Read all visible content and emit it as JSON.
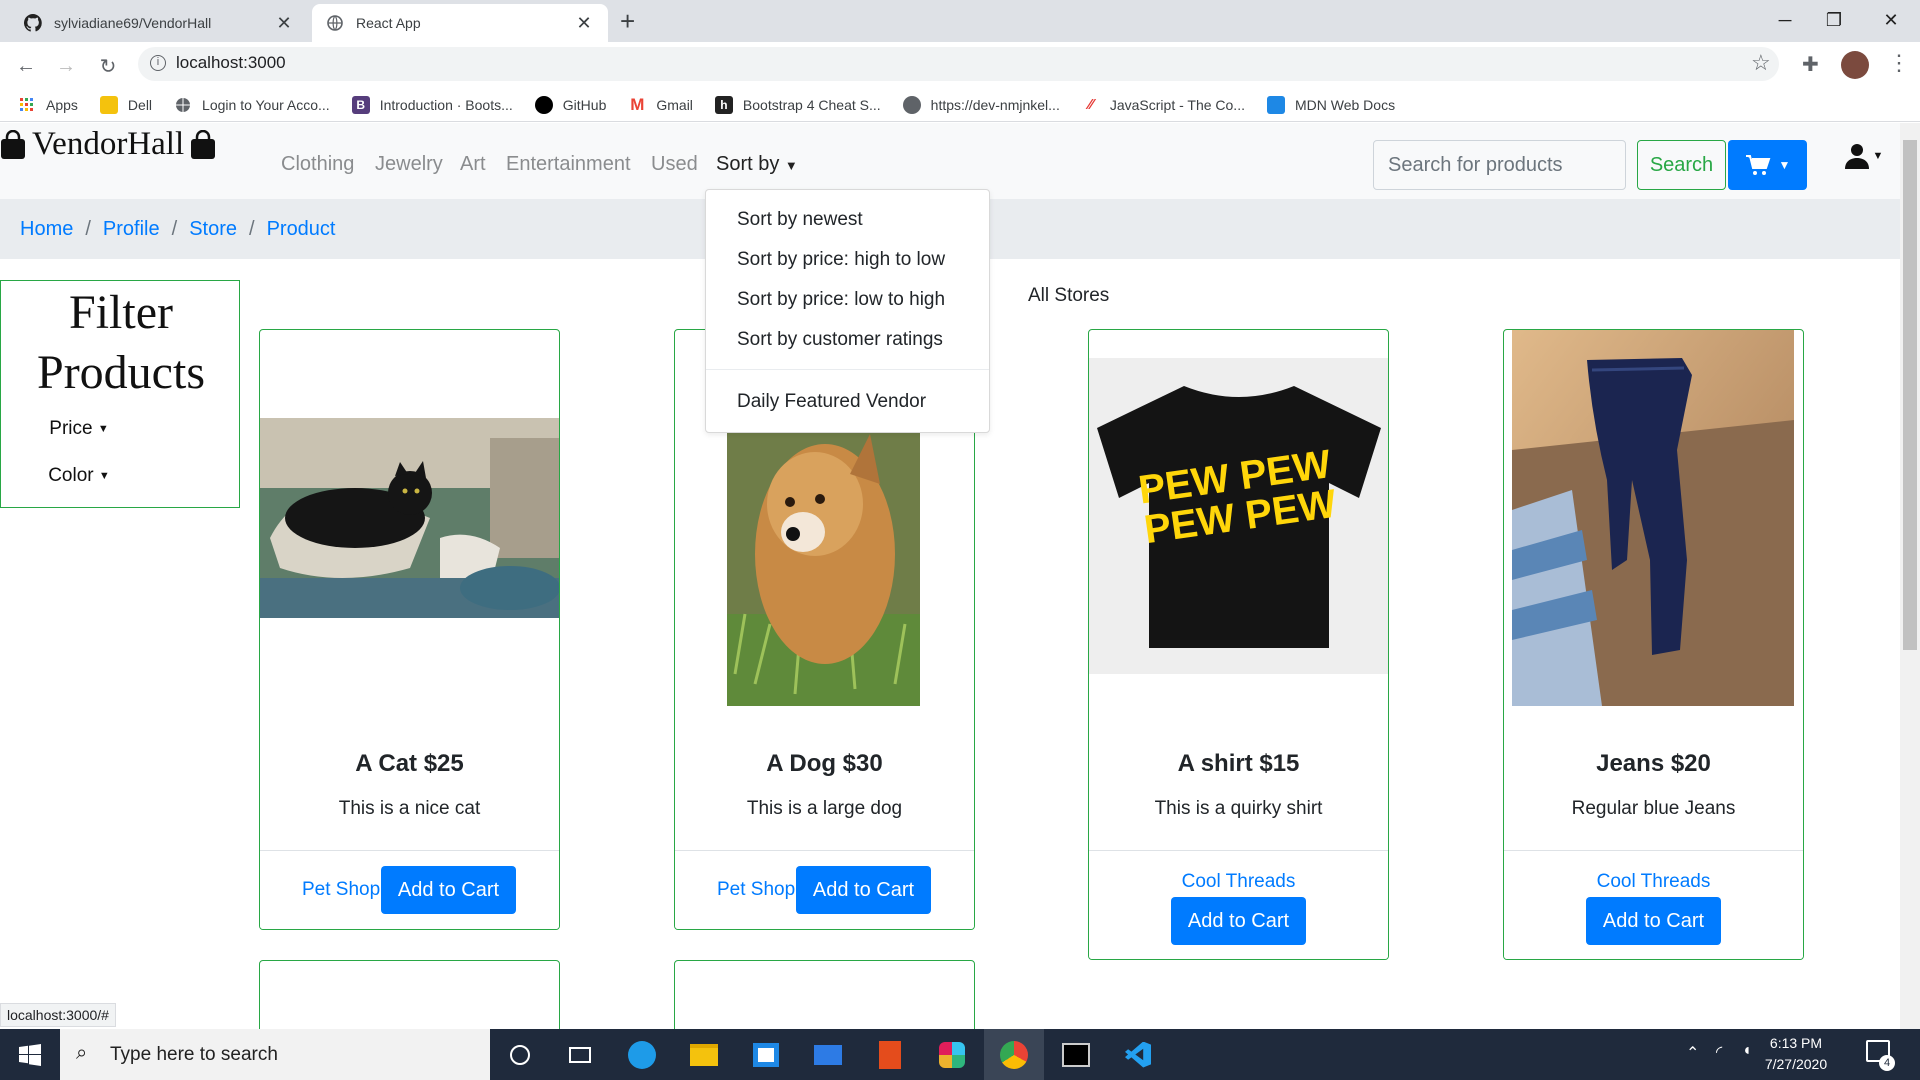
{
  "browser": {
    "tabs": [
      {
        "title": "sylviadiane69/VendorHall",
        "icon": "github-icon",
        "active": false
      },
      {
        "title": "React App",
        "icon": "globe-icon",
        "active": true
      }
    ],
    "url": "localhost:3000",
    "bookmarks": [
      {
        "label": "Apps",
        "icon": "apps-grid-icon",
        "color": "#ea4335"
      },
      {
        "label": "Dell",
        "icon": "folder-icon",
        "color": "#f4c20d"
      },
      {
        "label": "Login to Your Acco...",
        "icon": "globe-icon",
        "color": "#5f6368"
      },
      {
        "label": "Introduction · Boots...",
        "icon": "bootstrap-icon",
        "color": "#563d7c"
      },
      {
        "label": "GitHub",
        "icon": "github-icon",
        "color": "#000000"
      },
      {
        "label": "Gmail",
        "icon": "gmail-icon",
        "color": "#ea4335"
      },
      {
        "label": "Bootstrap 4 Cheat S...",
        "icon": "cheatsheet-icon",
        "color": "#222222"
      },
      {
        "label": "https://dev-nmjnkel...",
        "icon": "globe-icon",
        "color": "#5f6368"
      },
      {
        "label": "JavaScript - The Co...",
        "icon": "javascript-icon",
        "color": "#e53935"
      },
      {
        "label": "MDN Web Docs",
        "icon": "mdn-icon",
        "color": "#1e88e5"
      }
    ],
    "status_url": "localhost:3000/#"
  },
  "navbar": {
    "brand": "VendorHall",
    "links": [
      "Clothing",
      "Jewelry",
      "Art",
      "Entertainment",
      "Used"
    ],
    "sort_label": "Sort by",
    "search_placeholder": "Search for products",
    "search_button": "Search"
  },
  "breadcrumb": [
    "Home",
    "Profile",
    "Store",
    "Product"
  ],
  "sort_menu": {
    "items": [
      "Sort by newest",
      "Sort by price: high to low",
      "Sort by price: low to high",
      "Sort by customer ratings"
    ],
    "extra": "Daily Featured Vendor"
  },
  "filter": {
    "title": "Filter Products",
    "buttons": [
      "Price",
      "Color"
    ]
  },
  "heading": "All Stores",
  "products": [
    {
      "title": "A Cat $25",
      "description": "This is a nice cat",
      "vendor": "Pet Shop",
      "button": "Add to Cart",
      "image": "cat-photo"
    },
    {
      "title": "A Dog $30",
      "description": "This is a large dog",
      "vendor": "Pet Shop",
      "button": "Add to Cart",
      "image": "dog-photo"
    },
    {
      "title": "A shirt $15",
      "description": "This is a quirky shirt",
      "vendor": "Cool Threads",
      "button": "Add to Cart",
      "image": "shirt-photo",
      "shirt_text": "PEW PEW"
    },
    {
      "title": "Jeans $20",
      "description": "Regular blue Jeans",
      "vendor": "Cool Threads",
      "button": "Add to Cart",
      "image": "jeans-photo"
    }
  ],
  "taskbar": {
    "search_placeholder": "Type here to search",
    "time": "6:13 PM",
    "date": "7/27/2020",
    "notification_count": "4"
  },
  "colors": {
    "primary": "#007bff",
    "success": "#28a745",
    "taskbar": "#1f2a3c"
  }
}
